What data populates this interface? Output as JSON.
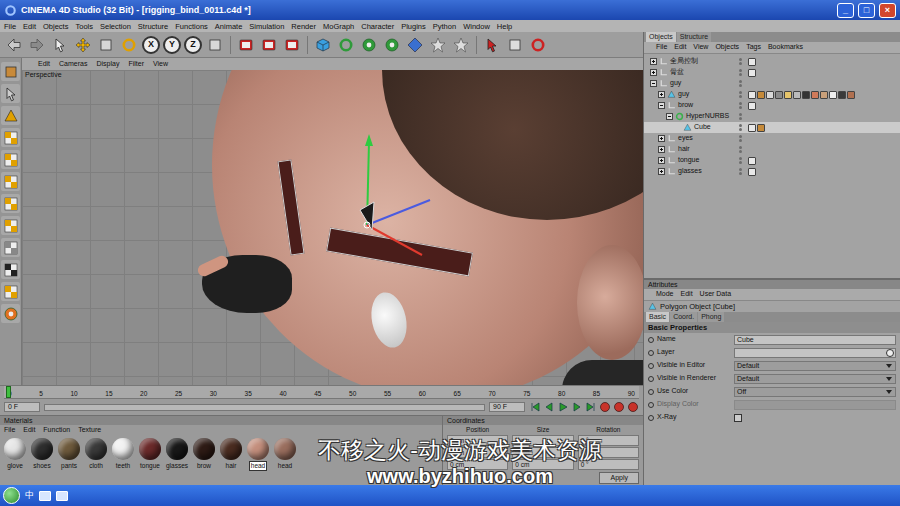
{
  "window": {
    "title": "CINEMA 4D Studio (32 Bit) - [rigging_bind_0011.c4d *]",
    "controls": [
      "_",
      "□",
      "×"
    ]
  },
  "menu": [
    "File",
    "Edit",
    "Objects",
    "Tools",
    "Selection",
    "Structure",
    "Functions",
    "Animate",
    "Simulation",
    "Render",
    "MoGraph",
    "Character",
    "Plugins",
    "Python",
    "Window",
    "Help"
  ],
  "toolbar": {
    "axis_buttons": [
      "X",
      "Y",
      "Z"
    ]
  },
  "viewport": {
    "menu": [
      "Edit",
      "Cameras",
      "Display",
      "Filter",
      "View"
    ],
    "label": "Perspective"
  },
  "timeline": {
    "ticks": [
      "0",
      "5",
      "10",
      "15",
      "20",
      "25",
      "30",
      "35",
      "40",
      "45",
      "50",
      "55",
      "60",
      "65",
      "70",
      "75",
      "80",
      "85",
      "90"
    ],
    "playhead_level": 0,
    "start": "0 F",
    "end": "90 F"
  },
  "materials": {
    "title": "Materials",
    "menu": [
      "File",
      "Edit",
      "Function",
      "Texture"
    ],
    "items": [
      {
        "name": "glove",
        "color": "#e6e6e6",
        "selected": false
      },
      {
        "name": "shoes",
        "color": "#2e2e2e",
        "selected": false
      },
      {
        "name": "pants",
        "color": "#6e5a3c",
        "selected": false
      },
      {
        "name": "cloth",
        "color": "#3a3a3a",
        "selected": false
      },
      {
        "name": "teeth",
        "color": "#f2f2f2",
        "selected": false
      },
      {
        "name": "tongue",
        "color": "#6b2a2a",
        "selected": false
      },
      {
        "name": "glasses",
        "color": "#181818",
        "selected": false
      },
      {
        "name": "brow",
        "color": "#2e1b15",
        "selected": false
      },
      {
        "name": "hair",
        "color": "#4a2c20",
        "selected": false
      },
      {
        "name": "head",
        "color": "#c48f7d",
        "selected": true
      },
      {
        "name": "head",
        "color": "#9a6e5e",
        "selected": false
      }
    ]
  },
  "coordinates": {
    "title": "Coordinates",
    "columns": [
      {
        "title": "Position",
        "values": [
          "0 cm",
          "0 cm",
          "0 cm"
        ]
      },
      {
        "title": "Size",
        "values": [
          "0 cm",
          "0 cm",
          "0 cm"
        ]
      },
      {
        "title": "Rotation",
        "values": [
          "0 °",
          "0 °",
          "0 °"
        ]
      }
    ],
    "apply": "Apply"
  },
  "objects": {
    "tabs": [
      {
        "label": "Objects",
        "selected": true
      },
      {
        "label": "Structure",
        "selected": false
      }
    ],
    "menu": [
      "File",
      "Edit",
      "View",
      "Objects",
      "Tags",
      "Bookmarks"
    ],
    "rows": [
      {
        "name": "全局控制",
        "depth": 0,
        "expanded": false,
        "selected": false,
        "kind": "null",
        "tags": 1
      },
      {
        "name": "骨盆",
        "depth": 0,
        "expanded": false,
        "selected": false,
        "kind": "null",
        "tags": 1
      },
      {
        "name": "guy",
        "depth": 0,
        "expanded": true,
        "selected": false,
        "kind": "null",
        "tags": 0
      },
      {
        "name": "guy",
        "depth": 1,
        "expanded": false,
        "selected": false,
        "kind": "polygon",
        "tags": 12
      },
      {
        "name": "brow",
        "depth": 1,
        "expanded": true,
        "selected": false,
        "kind": "null",
        "tags": 1
      },
      {
        "name": "HyperNURBS",
        "depth": 2,
        "expanded": true,
        "selected": false,
        "kind": "nurbs",
        "tags": 0
      },
      {
        "name": "Cube",
        "depth": 3,
        "selected": true,
        "kind": "polygon",
        "tags": 2
      },
      {
        "name": "eyes",
        "depth": 1,
        "expanded": false,
        "selected": false,
        "kind": "null",
        "tags": 0
      },
      {
        "name": "hair",
        "depth": 1,
        "expanded": false,
        "selected": false,
        "kind": "null",
        "tags": 0
      },
      {
        "name": "tongue",
        "depth": 1,
        "expanded": false,
        "selected": false,
        "kind": "null",
        "tags": 1
      },
      {
        "name": "glasses",
        "depth": 1,
        "expanded": false,
        "selected": false,
        "kind": "null",
        "tags": 1
      }
    ]
  },
  "attributes": {
    "title": "Attributes",
    "menu": [
      "Mode",
      "Edit",
      "User Data"
    ],
    "object": "Polygon Object [Cube]",
    "tabs": [
      {
        "label": "Basic",
        "selected": true
      },
      {
        "label": "Coord.",
        "selected": false
      },
      {
        "label": "Phong",
        "selected": false
      }
    ],
    "section": "Basic Properties",
    "fields": [
      {
        "label": "Name",
        "kind": "text",
        "value": "Cube",
        "disabled": false
      },
      {
        "label": "Layer",
        "kind": "link",
        "disabled": false
      },
      {
        "label": "Visible in Editor",
        "kind": "select",
        "value": "Default",
        "disabled": false
      },
      {
        "label": "Visible in Renderer",
        "kind": "select",
        "value": "Default",
        "disabled": false
      },
      {
        "label": "Use Color",
        "kind": "select",
        "value": "Off",
        "disabled": false
      },
      {
        "label": "Display Color",
        "kind": "color",
        "disabled": true
      },
      {
        "label": "X-Ray",
        "kind": "checkbox",
        "checked": false,
        "disabled": false
      }
    ]
  },
  "watermark": {
    "lines": [
      "不移之火-动漫游戏美术资源",
      "www.byzhihuo.com"
    ]
  },
  "taskbar": {
    "ime": "中"
  }
}
